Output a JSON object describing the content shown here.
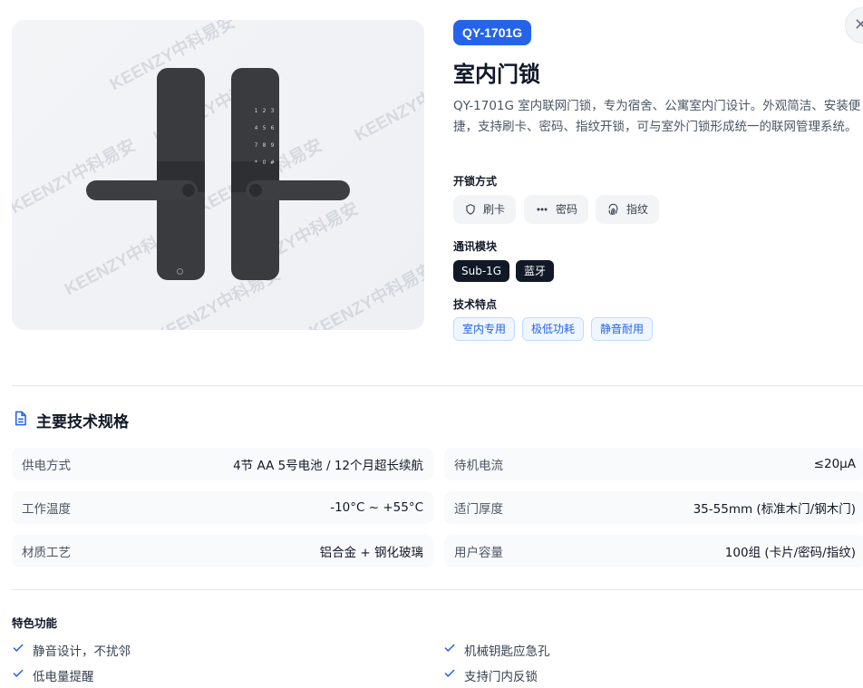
{
  "product": {
    "watermark_text": "KEENZY中科易安",
    "model": "QY-1701G",
    "title": "室内门锁",
    "description": "QY-1701G 室内联网门锁，专为宿舍、公寓室内门设计。外观简洁、安装便捷，支持刷卡、密码、指纹开锁，可与室外门锁形成统一的联网管理系统。",
    "keypad_keys": [
      "1",
      "2",
      "3",
      "4",
      "5",
      "6",
      "7",
      "8",
      "9",
      "*",
      "0",
      "#"
    ]
  },
  "close_icon": "close-icon",
  "unlock": {
    "label": "开锁方式",
    "methods": [
      {
        "label": "刷卡",
        "icon": "shield-icon"
      },
      {
        "label": "密码",
        "icon": "dots-icon"
      },
      {
        "label": "指纹",
        "icon": "fingerprint-icon"
      }
    ]
  },
  "comm": {
    "label": "通讯模块",
    "tags": [
      "Sub-1G",
      "蓝牙"
    ]
  },
  "tech": {
    "label": "技术特点",
    "tags": [
      "室内专用",
      "极低功耗",
      "静音耐用"
    ]
  },
  "specs": {
    "heading": "主要技术规格",
    "heading_icon": "document-icon",
    "rows": [
      {
        "label": "供电方式",
        "value": "4节 AA 5号电池 / 12个月超长续航"
      },
      {
        "label": "待机电流",
        "value": "≤20μA"
      },
      {
        "label": "工作温度",
        "value": "-10°C ~ +55°C"
      },
      {
        "label": "适门厚度",
        "value": "35-55mm (标准木门/钢木门)"
      },
      {
        "label": "材质工艺",
        "value": "铝合金 + 钢化玻璃"
      },
      {
        "label": "用户容量",
        "value": "100组 (卡片/密码/指纹)"
      }
    ]
  },
  "features": {
    "title": "特色功能",
    "items": [
      "静音设计，不扰邻",
      "机械钥匙应急孔",
      "低电量提醒",
      "支持门内反锁"
    ]
  },
  "colors": {
    "accent": "#2563eb",
    "dark_tag": "#111827",
    "lock_body": "#3a3b3f"
  }
}
